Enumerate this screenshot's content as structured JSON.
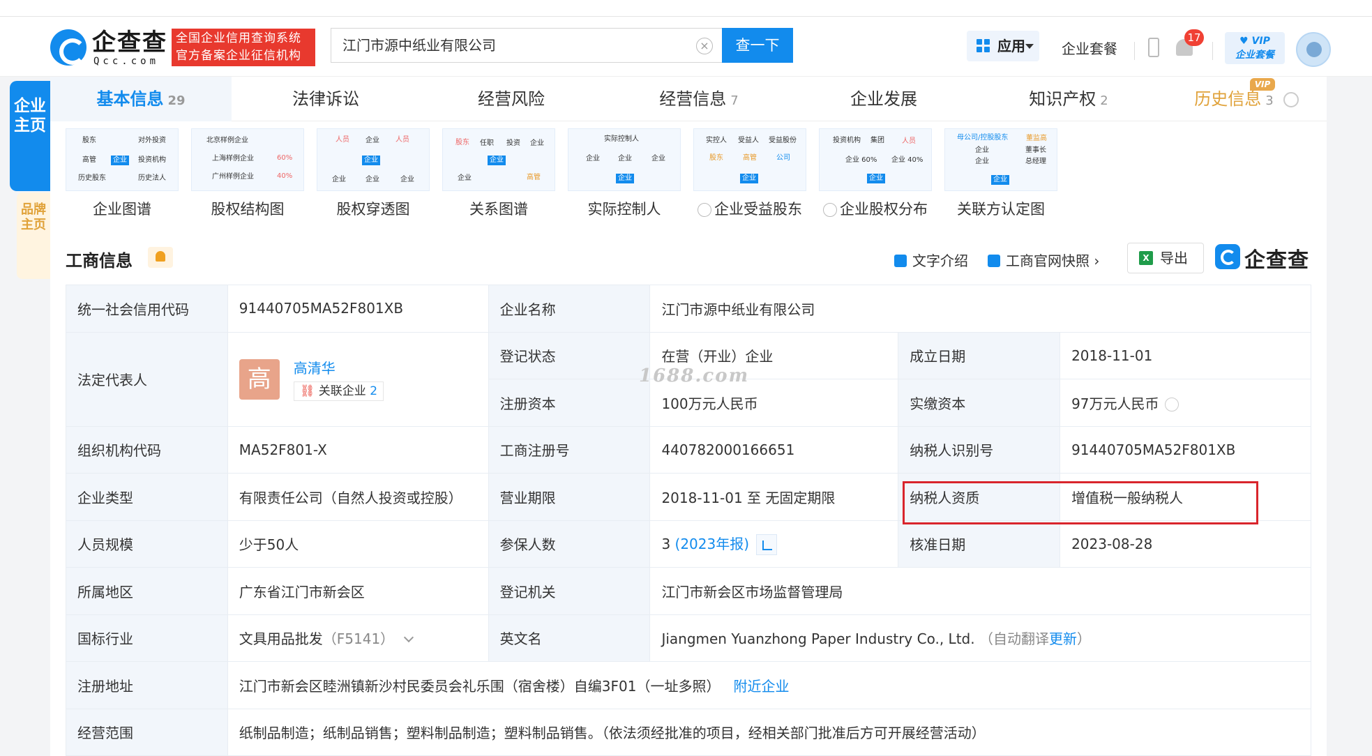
{
  "header": {
    "logo_cn": "企查查",
    "logo_en": "Qcc.com",
    "badge_line1": "全国企业信用查询系统",
    "badge_line2": "官方备案企业征信机构",
    "search_value": "江门市源中纸业有限公司",
    "search_button": "查一下",
    "app_button": "应用",
    "package": "企业套餐",
    "notification_count": "17",
    "vip_line1": "♥ VIP",
    "vip_line2": "企业套餐"
  },
  "side_tabs": {
    "company_home": "企业主页",
    "brand_home": "品牌主页"
  },
  "tabs": [
    {
      "label": "基本信息",
      "count": "29"
    },
    {
      "label": "法律诉讼",
      "count": ""
    },
    {
      "label": "经营风险",
      "count": ""
    },
    {
      "label": "经营信息",
      "count": "7"
    },
    {
      "label": "企业发展",
      "count": ""
    },
    {
      "label": "知识产权",
      "count": "2"
    },
    {
      "label": "历史信息",
      "count": "3",
      "tag": "VIP"
    }
  ],
  "diagrams": [
    {
      "label": "企业图谱"
    },
    {
      "label": "股权结构图"
    },
    {
      "label": "股权穿透图"
    },
    {
      "label": "关系图谱"
    },
    {
      "label": "实际控制人"
    },
    {
      "label": "企业受益股东"
    },
    {
      "label": "企业股权分布"
    },
    {
      "label": "关联方认定图"
    }
  ],
  "diagram_thumbs": {
    "t1": [
      "股东",
      "对外投资",
      "高管",
      "企业",
      "投资机构",
      "历史股东",
      "历史法人"
    ],
    "t2": [
      "北京样例企业",
      "上海样例企业",
      "60%",
      "广州样例企业",
      "40%"
    ],
    "t3": [
      "人员",
      "企业",
      "人员",
      "企业",
      "企业",
      "企业",
      "企业"
    ],
    "t4": [
      "股东",
      "任职",
      "投资",
      "企业",
      "企业",
      "企业",
      "高管"
    ],
    "t5": [
      "实际控制人",
      "企业",
      "企业",
      "企业",
      "企业"
    ],
    "t6": [
      "实控人",
      "受益人",
      "受益股份",
      "股东",
      "高管",
      "公司",
      "企业"
    ],
    "t7": [
      "投资机构",
      "集团",
      "人员",
      "企业 60%",
      "企业 40%",
      "企业"
    ],
    "t8": [
      "母公司/控股股东",
      "董监高",
      "企业",
      "董事长",
      "企业",
      "总经理",
      "企业"
    ]
  },
  "section": {
    "title": "工商信息",
    "text_intro": "文字介绍",
    "snapshot": "工商官网快照",
    "export": "导出",
    "brand": "企查查"
  },
  "info": {
    "credit_code_label": "统一社会信用代码",
    "credit_code": "91440705MA52F801XB",
    "name_label": "企业名称",
    "name": "江门市源中纸业有限公司",
    "legal_rep_label": "法定代表人",
    "legal_rep_avatar": "高",
    "legal_rep_name": "高清华",
    "legal_rep_related": "关联企业",
    "legal_rep_related_count": "2",
    "status_label": "登记状态",
    "status": "在营（开业）企业",
    "founded_label": "成立日期",
    "founded": "2018-11-01",
    "reg_capital_label": "注册资本",
    "reg_capital": "100万元人民币",
    "paid_capital_label": "实缴资本",
    "paid_capital": "97万元人民币",
    "org_code_label": "组织机构代码",
    "org_code": "MA52F801-X",
    "reg_no_label": "工商注册号",
    "reg_no": "440782000166651",
    "taxpayer_id_label": "纳税人识别号",
    "taxpayer_id": "91440705MA52F801XB",
    "type_label": "企业类型",
    "type": "有限责任公司（自然人投资或控股）",
    "term_label": "营业期限",
    "term": "2018-11-01 至 无固定期限",
    "tax_qual_label": "纳税人资质",
    "tax_qual": "增值税一般纳税人",
    "size_label": "人员规模",
    "size": "少于50人",
    "insured_label": "参保人数",
    "insured": "3",
    "insured_year": "(2023年报)",
    "approve_label": "核准日期",
    "approve": "2023-08-28",
    "region_label": "所属地区",
    "region": "广东省江门市新会区",
    "authority_label": "登记机关",
    "authority": "江门市新会区市场监督管理局",
    "industry_label": "国标行业",
    "industry": "文具用品批发",
    "industry_code": "（F5141）",
    "en_name_label": "英文名",
    "en_name": "Jiangmen Yuanzhong Paper Industry Co., Ltd.",
    "en_name_note": "（自动翻译",
    "en_name_update": "更新",
    "en_name_close": "）",
    "address_label": "注册地址",
    "address": "江门市新会区睦洲镇新沙村民委员会礼乐围（宿舍楼）自编3F01（一址多照）",
    "nearby": "附近企业",
    "scope_label": "经营范围",
    "scope": "纸制品制造；纸制品销售；塑料制品制造；塑料制品销售。（依法须经批准的项目，经相关部门批准后方可开展经营活动）"
  },
  "watermark": "1688.com",
  "colors": {
    "accent": "#128bed",
    "highlight": "#d9252c",
    "badge": "#e8392e"
  }
}
